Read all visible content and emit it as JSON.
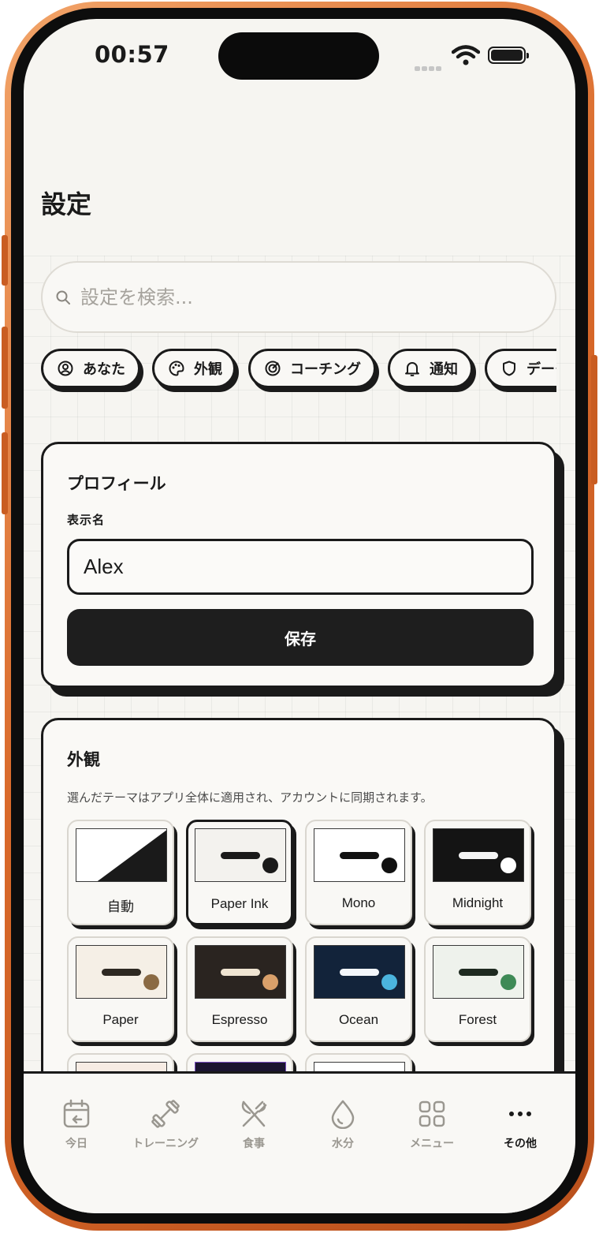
{
  "status_bar": {
    "time": "00:57"
  },
  "header": {
    "title": "設定"
  },
  "search": {
    "placeholder": "設定を検索..."
  },
  "chips": [
    {
      "label": "あなた",
      "icon": "user-circle-icon"
    },
    {
      "label": "外観",
      "icon": "palette-icon"
    },
    {
      "label": "コーチング",
      "icon": "target-icon"
    },
    {
      "label": "通知",
      "icon": "bell-icon"
    },
    {
      "label": "データ",
      "icon": "shield-icon"
    }
  ],
  "profile": {
    "title": "プロフィール",
    "field_label": "表示名",
    "display_name": "Alex",
    "save_label": "保存"
  },
  "appearance": {
    "title": "外観",
    "description": "選んだテーマはアプリ全体に適用され、アカウントに同期されます。",
    "selected": "Paper Ink",
    "themes": [
      {
        "label": "自動",
        "bg": "#ffffff",
        "accent": "#1a1a1a"
      },
      {
        "label": "Paper Ink",
        "bg": "#f3f2ee",
        "bar": "#1a1a1a",
        "dot": "#1a1a1a"
      },
      {
        "label": "Mono",
        "bg": "#ffffff",
        "bar": "#111111",
        "dot": "#111111"
      },
      {
        "label": "Midnight",
        "bg": "#141414",
        "bar": "#f5f5f5",
        "dot": "#ffffff"
      },
      {
        "label": "Paper",
        "bg": "#f5efe6",
        "bar": "#2d2822",
        "dot": "#8a6a44"
      },
      {
        "label": "Espresso",
        "bg": "#2a2420",
        "bar": "#efe4d2",
        "dot": "#d9a06a"
      },
      {
        "label": "Ocean",
        "bg": "#12233a",
        "bar": "#f3f6fa",
        "dot": "#4bb4dd"
      },
      {
        "label": "Forest",
        "bg": "#eef2ec",
        "bar": "#1e2a20",
        "dot": "#3e8a56"
      },
      {
        "label": "",
        "bg": "#f7ece4"
      },
      {
        "label": "",
        "bg": "#1b1530"
      },
      {
        "label": "",
        "bg": "#ffffff"
      }
    ]
  },
  "tabs": [
    {
      "label": "今日",
      "icon": "calendar-icon"
    },
    {
      "label": "トレーニング",
      "icon": "dumbbell-icon"
    },
    {
      "label": "食事",
      "icon": "utensils-icon"
    },
    {
      "label": "水分",
      "icon": "droplet-icon"
    },
    {
      "label": "メニュー",
      "icon": "grid-icon"
    },
    {
      "label": "その他",
      "icon": "more-icon",
      "active": true
    }
  ]
}
